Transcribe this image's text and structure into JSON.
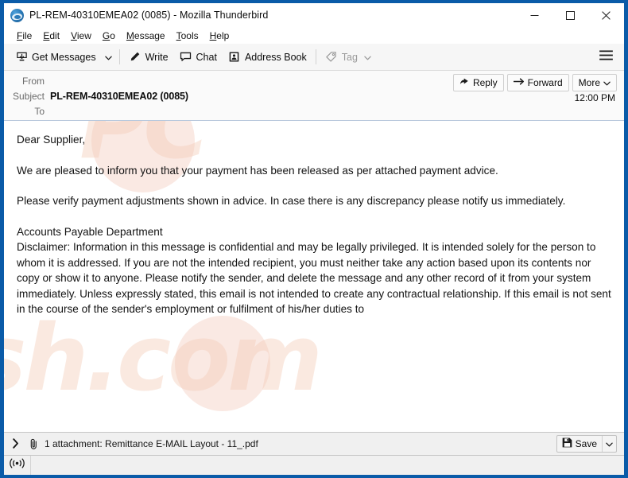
{
  "window": {
    "title": "PL-REM-40310EMEA02 (0085) - Mozilla Thunderbird",
    "logo_icon": "thunderbird-logo-icon",
    "controls": {
      "minimize": "minimize-icon",
      "maximize": "maximize-icon",
      "close": "close-icon"
    },
    "frame_color": "#0a5ba8"
  },
  "menu_bar": {
    "items": [
      {
        "label": "File",
        "accesskey": "F"
      },
      {
        "label": "Edit",
        "accesskey": "E"
      },
      {
        "label": "View",
        "accesskey": "V"
      },
      {
        "label": "Go",
        "accesskey": "G"
      },
      {
        "label": "Message",
        "accesskey": "M"
      },
      {
        "label": "Tools",
        "accesskey": "T"
      },
      {
        "label": "Help",
        "accesskey": "H"
      }
    ]
  },
  "toolbar": {
    "get_messages_label": "Get Messages",
    "get_messages_icon": "inbox-download-icon",
    "get_messages_dropdown_icon": "chevron-down-icon",
    "write_label": "Write",
    "write_icon": "pencil-icon",
    "chat_label": "Chat",
    "chat_icon": "speech-bubble-icon",
    "address_book_label": "Address Book",
    "address_book_icon": "address-book-icon",
    "tag_label": "Tag",
    "tag_icon": "tag-icon",
    "tag_dropdown_icon": "chevron-down-icon",
    "tag_disabled": true,
    "app_menu_icon": "hamburger-menu-icon"
  },
  "message_header": {
    "from_label": "From",
    "from_value": "",
    "subject_label": "Subject",
    "subject_value": "PL-REM-40310EMEA02 (0085)",
    "to_label": "To",
    "to_value": "",
    "time": "12:00 PM",
    "buttons": {
      "reply_label": "Reply",
      "reply_icon": "reply-arrow-icon",
      "forward_label": "Forward",
      "forward_icon": "forward-arrow-icon",
      "more_label": "More",
      "more_icon": "chevron-down-icon"
    }
  },
  "message_body": {
    "greeting": "Dear Supplier,",
    "paragraph_1": "We are pleased to inform you that your payment has been released as per attached payment advice.",
    "paragraph_2": "Please verify payment adjustments shown in advice. In case there is any discrepancy please notify us immediately.",
    "signature": "Accounts Payable Department",
    "disclaimer": "Disclaimer: Information in this message is confidential and may be legally privileged. It is intended solely for the person to whom it is addressed. If you are not the intended recipient, you must neither take any action based upon its contents nor copy or show it to anyone. Please notify the sender, and delete the message and any other record of it from your system immediately. Unless expressly stated, this email is not intended to create any contractual relationship. If this email is not sent in the course of the sender's employment or fulfilment of his/her duties to"
  },
  "watermark": {
    "line_1": "PC",
    "line_2": "sh.com",
    "color": "#f3c9b4"
  },
  "attachment_bar": {
    "expander_icon": "chevron-right-icon",
    "clip_icon": "paperclip-icon",
    "label": "1 attachment: Remittance E-MAIL Layout - 11_.pdf",
    "save_label": "Save",
    "save_icon": "save-disk-icon",
    "save_dropdown_icon": "chevron-down-icon"
  },
  "status_bar": {
    "connection_icon": "broadcast-signal-icon"
  }
}
